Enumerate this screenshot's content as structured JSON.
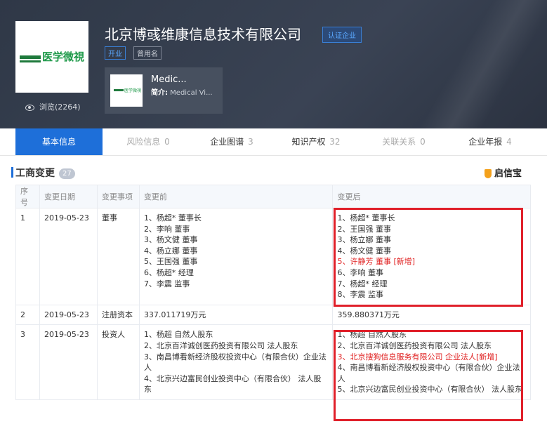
{
  "company": {
    "name": "北京博彧维康信息技术有限公司",
    "cert_badge": "认证企业",
    "tags": [
      "开业",
      "曾用名"
    ],
    "logo_text": "医学微視",
    "views": "浏览(2264)"
  },
  "product": {
    "name": "Medic...",
    "desc_label": "简介:",
    "desc_text": " Medical Vi..."
  },
  "tabs": [
    {
      "label": "基本信息",
      "count": ""
    },
    {
      "label": "风险信息",
      "count": "0"
    },
    {
      "label": "企业图谱",
      "count": "3"
    },
    {
      "label": "知识产权",
      "count": "32"
    },
    {
      "label": "关联关系",
      "count": "0"
    },
    {
      "label": "企业年报",
      "count": "4"
    }
  ],
  "section": {
    "title": "工商变更",
    "count": "27",
    "brand": "启信宝"
  },
  "table": {
    "headers": [
      "序号",
      "变更日期",
      "变更事项",
      "变更前",
      "变更后"
    ],
    "rows": [
      {
        "index": "1",
        "date": "2019-05-23",
        "item": "董事",
        "before": [
          "1、杨超* 董事长",
          "2、李响 董事",
          "3、杨文健 董事",
          "4、杨立娜 董事",
          "5、王国强 董事",
          "6、杨超* 经理",
          "7、李震 监事"
        ],
        "after": [
          {
            "text": "1、杨超* 董事长",
            "highlight": false
          },
          {
            "text": "2、王国强 董事",
            "highlight": false
          },
          {
            "text": "3、杨立娜 董事",
            "highlight": false
          },
          {
            "text": "4、杨文健 董事",
            "highlight": false
          },
          {
            "text": "5、许静芳 董事 [新增]",
            "highlight": true
          },
          {
            "text": "6、李响 董事",
            "highlight": false
          },
          {
            "text": "7、杨超* 经理",
            "highlight": false
          },
          {
            "text": "8、李震 监事",
            "highlight": false
          }
        ]
      },
      {
        "index": "2",
        "date": "2019-05-23",
        "item": "注册资本",
        "before": [
          "337.011719万元"
        ],
        "after": [
          {
            "text": "359.880371万元",
            "highlight": false
          }
        ]
      },
      {
        "index": "3",
        "date": "2019-05-23",
        "item": "投资人",
        "before": [
          "1、杨超 自然人股东",
          "2、北京百洋诚创医药投资有限公司 法人股东",
          "3、南昌博看新经济股权投资中心（有限合伙）企业法人",
          "4、北京兴边富民创业投资中心（有限合伙） 法人股东"
        ],
        "after": [
          {
            "text": "1、杨超 自然人股东",
            "highlight": false
          },
          {
            "text": "2、北京百洋诚创医药投资有限公司 法人股东",
            "highlight": false
          },
          {
            "text": "3、北京搜狗信息服务有限公司 企业法人[新增]",
            "highlight": true
          },
          {
            "text": "4、南昌博看新经济股权投资中心（有限合伙）企业法人",
            "highlight": false
          },
          {
            "text": "5、北京兴边富民创业投资中心（有限合伙） 法人股东",
            "highlight": false
          }
        ]
      }
    ]
  }
}
